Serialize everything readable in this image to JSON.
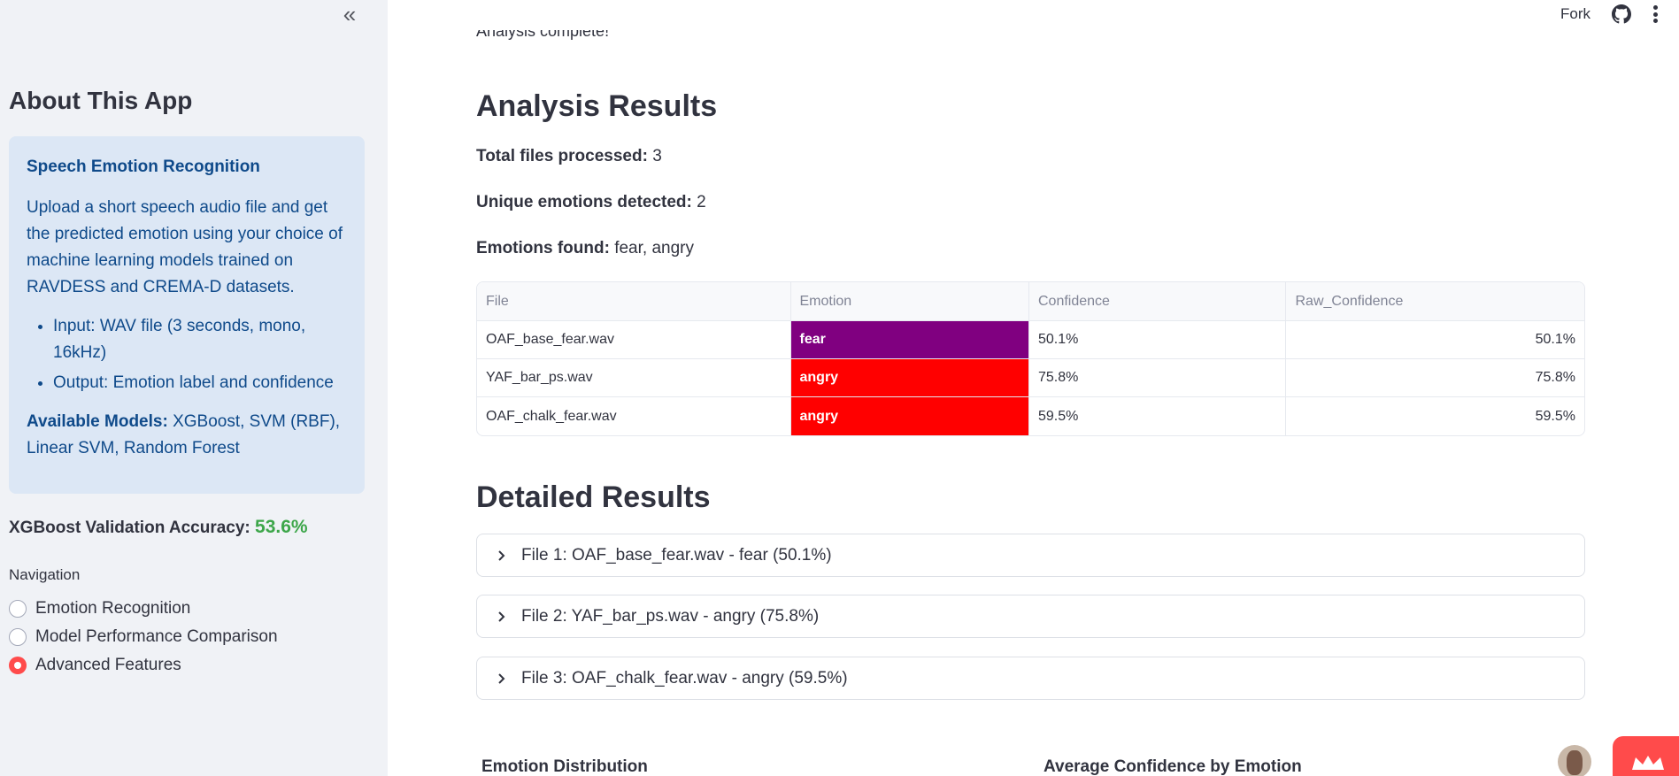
{
  "sidebar": {
    "collapse_glyph": "«",
    "title": "About This App",
    "info": {
      "title": "Speech Emotion Recognition",
      "description": "Upload a short speech audio file and get the predicted emotion using your choice of machine learning models trained on RAVDESS and CREMA-D datasets.",
      "bullets": [
        "Input: WAV file (3 seconds, mono, 16kHz)",
        "Output: Emotion label and confidence"
      ],
      "models_label": "Available Models:",
      "models_value": " XGBoost, SVM (RBF), Linear SVM, Random Forest"
    },
    "accuracy_label": "XGBoost Validation Accuracy: ",
    "accuracy_value": "53.6%",
    "nav_label": "Navigation",
    "nav_items": [
      {
        "label": "Emotion Recognition",
        "selected": false
      },
      {
        "label": "Model Performance Comparison",
        "selected": false
      },
      {
        "label": "Advanced Features",
        "selected": true
      }
    ]
  },
  "topbar": {
    "fork_label": "Fork",
    "github_icon": "github-icon",
    "menu_icon": "kebab-menu-icon"
  },
  "main": {
    "cut_text": "Analysis complete!",
    "results_title": "Analysis Results",
    "stats": {
      "total_label": "Total files processed:",
      "total_value": " 3",
      "unique_label": "Unique emotions detected:",
      "unique_value": " 2",
      "found_label": "Emotions found:",
      "found_value": " fear, angry"
    },
    "table": {
      "headers": [
        "File",
        "Emotion",
        "Confidence",
        "Raw_Confidence"
      ],
      "rows": [
        {
          "file": "OAF_base_fear.wav",
          "emotion": "fear",
          "confidence": "50.1%",
          "raw": "50.1%"
        },
        {
          "file": "YAF_bar_ps.wav",
          "emotion": "angry",
          "confidence": "75.8%",
          "raw": "75.8%"
        },
        {
          "file": "OAF_chalk_fear.wav",
          "emotion": "angry",
          "confidence": "59.5%",
          "raw": "59.5%"
        }
      ]
    },
    "detailed_title": "Detailed Results",
    "expanders": [
      "File 1: OAF_base_fear.wav - fear (50.1%)",
      "File 2: YAF_bar_ps.wav - angry (75.8%)",
      "File 3: OAF_chalk_fear.wav - angry (59.5%)"
    ],
    "distribution_title": "Emotion Distribution",
    "avg_conf_title": "Average Confidence by Emotion"
  },
  "colors": {
    "fear": "#800080",
    "angry": "#ff0000",
    "accent": "#ff4b4b",
    "accuracy": "#3da64a"
  }
}
